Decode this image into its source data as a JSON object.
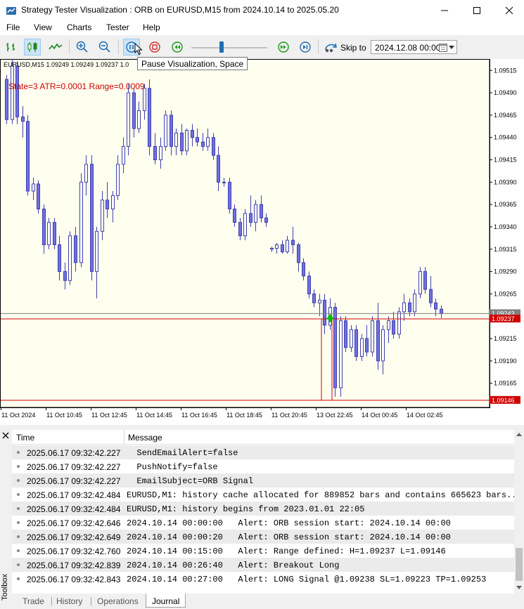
{
  "window": {
    "title": "Strategy Tester Visualization : ORB on EURUSD,M15 from 2024.10.14 to 2025.05.20"
  },
  "menu": [
    "File",
    "View",
    "Charts",
    "Tester",
    "Help"
  ],
  "toolbar": {
    "skip_label": "Skip to",
    "skip_date": "2024.12.08 00:00",
    "tooltip": "Pause Visualization, Space",
    "speed_fraction": 0.4
  },
  "chart": {
    "symbol_info": "EURUSD,M15  1.09249 1.09249 1.09237 1.0",
    "state_text": "State=3 ATR=0.0001 Range=0.0009",
    "ylim": [
      1.09138,
      1.09527
    ],
    "y_ticks": [
      "1.09515",
      "1.09490",
      "1.09465",
      "1.09440",
      "1.09415",
      "1.09390",
      "1.09365",
      "1.09340",
      "1.09315",
      "1.09290",
      "1.09265",
      "1.09215",
      "1.09190",
      "1.09165"
    ],
    "price_tags": [
      {
        "label": "1.09243",
        "value": 1.09243,
        "color": "#808080"
      },
      {
        "label": "1.09237",
        "value": 1.09237,
        "color": "#d00000"
      },
      {
        "label": "1.09146",
        "value": 1.09146,
        "color": "#d00000"
      }
    ],
    "x_ticks": [
      "11 Oct 2024",
      "11 Oct 10:45",
      "11 Oct 12:45",
      "11 Oct 14:45",
      "11 Oct 16:45",
      "11 Oct 18:45",
      "11 Oct 20:45",
      "13 Oct 22:45",
      "14 Oct 00:45",
      "14 Oct 02:45"
    ],
    "colors": {
      "bg": "#fffff0",
      "bull": "#ffffff",
      "bear": "#7070e0",
      "outline": "#4040b0",
      "range": "#cc0000",
      "arrow": "#00c000"
    }
  },
  "chart_data": {
    "type": "candlestick",
    "ohlc": [
      [
        1.09505,
        1.0951,
        1.09455,
        1.0946
      ],
      [
        1.0946,
        1.0953,
        1.09455,
        1.0952
      ],
      [
        1.0952,
        1.09525,
        1.09455,
        1.09463
      ],
      [
        1.09463,
        1.09475,
        1.0944,
        1.09458
      ],
      [
        1.09458,
        1.09465,
        1.09375,
        1.0938
      ],
      [
        1.0938,
        1.09395,
        1.0937,
        1.09388
      ],
      [
        1.09388,
        1.09392,
        1.09355,
        1.0936
      ],
      [
        1.0936,
        1.09365,
        1.0931,
        1.0932
      ],
      [
        1.0932,
        1.0935,
        1.09315,
        1.09345
      ],
      [
        1.09345,
        1.0935,
        1.09315,
        1.0932
      ],
      [
        1.0932,
        1.0933,
        1.0928,
        1.0929
      ],
      [
        1.0929,
        1.093,
        1.0927,
        1.0928
      ],
      [
        1.0928,
        1.09335,
        1.09275,
        1.0933
      ],
      [
        1.0933,
        1.0934,
        1.0929,
        1.093
      ],
      [
        1.093,
        1.094,
        1.09295,
        1.0939
      ],
      [
        1.0939,
        1.0942,
        1.09375,
        1.0941
      ],
      [
        1.0941,
        1.0942,
        1.0928,
        1.0929
      ],
      [
        1.0929,
        1.0934,
        1.0926,
        1.09335
      ],
      [
        1.09335,
        1.0938,
        1.09325,
        1.0937
      ],
      [
        1.0937,
        1.0939,
        1.0935,
        1.0936
      ],
      [
        1.0936,
        1.0938,
        1.09345,
        1.09375
      ],
      [
        1.09375,
        1.0942,
        1.0937,
        1.0941
      ],
      [
        1.0941,
        1.0944,
        1.094,
        1.0943
      ],
      [
        1.0943,
        1.095,
        1.0942,
        1.0949
      ],
      [
        1.0949,
        1.09495,
        1.0944,
        1.0945
      ],
      [
        1.0945,
        1.0948,
        1.09445,
        1.0947
      ],
      [
        1.0947,
        1.095,
        1.0946,
        1.09495
      ],
      [
        1.09495,
        1.09505,
        1.0942,
        1.0943
      ],
      [
        1.0943,
        1.09445,
        1.0941,
        1.09415
      ],
      [
        1.09415,
        1.0944,
        1.09405,
        1.0943
      ],
      [
        1.0943,
        1.0947,
        1.09425,
        1.09465
      ],
      [
        1.09465,
        1.0947,
        1.0942,
        1.0943
      ],
      [
        1.0943,
        1.0945,
        1.0942,
        1.09445
      ],
      [
        1.09445,
        1.09455,
        1.0942,
        1.09425
      ],
      [
        1.09425,
        1.0945,
        1.0942,
        1.09448
      ],
      [
        1.09448,
        1.09455,
        1.0943,
        1.0944
      ],
      [
        1.0944,
        1.0945,
        1.0943,
        1.09435
      ],
      [
        1.09435,
        1.09445,
        1.09425,
        1.0943
      ],
      [
        1.0943,
        1.0945,
        1.09425,
        1.0944
      ],
      [
        1.0944,
        1.09445,
        1.09415,
        1.0942
      ],
      [
        1.0942,
        1.0943,
        1.0938,
        1.0939
      ],
      [
        1.0939,
        1.09395,
        1.09385,
        1.0939
      ],
      [
        1.0939,
        1.09395,
        1.09355,
        1.0936
      ],
      [
        1.0936,
        1.09365,
        1.0934,
        1.09345
      ],
      [
        1.09345,
        1.0935,
        1.09325,
        1.0933
      ],
      [
        1.0933,
        1.0936,
        1.09325,
        1.09355
      ],
      [
        1.09355,
        1.09375,
        1.0934,
        1.09345
      ],
      [
        1.09345,
        1.0937,
        1.09335,
        1.09365
      ],
      [
        1.09365,
        1.09375,
        1.09345,
        1.0935
      ],
      [
        1.0935,
        1.09355,
        1.0934,
        1.09345
      ],
      [
        1.09315,
        1.09318,
        1.09312,
        1.09316
      ],
      [
        1.09316,
        1.09322,
        1.0931,
        1.0932
      ],
      [
        1.0932,
        1.09325,
        1.0931,
        1.09312
      ],
      [
        1.09312,
        1.0933,
        1.0931,
        1.09325
      ],
      [
        1.09325,
        1.0934,
        1.0931,
        1.0932
      ],
      [
        1.0932,
        1.09322,
        1.0929,
        1.093
      ],
      [
        1.093,
        1.09305,
        1.0928,
        1.09285
      ],
      [
        1.09285,
        1.0929,
        1.0926,
        1.09265
      ],
      [
        1.09265,
        1.0927,
        1.0925,
        1.09255
      ],
      [
        1.09255,
        1.09265,
        1.0924,
        1.09258
      ],
      [
        1.09258,
        1.09265,
        1.0922,
        1.0923
      ],
      [
        1.0923,
        1.0926,
        1.09225,
        1.0925
      ],
      [
        1.0925,
        1.09255,
        1.0915,
        1.0916
      ],
      [
        1.0916,
        1.0924,
        1.0915,
        1.09235
      ],
      [
        1.09235,
        1.0924,
        1.092,
        1.09205
      ],
      [
        1.09205,
        1.0923,
        1.092,
        1.09225
      ],
      [
        1.09225,
        1.0923,
        1.0919,
        1.09195
      ],
      [
        1.09195,
        1.0922,
        1.0919,
        1.09215
      ],
      [
        1.09215,
        1.0923,
        1.09195,
        1.092
      ],
      [
        1.092,
        1.0924,
        1.09195,
        1.09235
      ],
      [
        1.09235,
        1.09255,
        1.0918,
        1.0919
      ],
      [
        1.0919,
        1.0923,
        1.09175,
        1.09225
      ],
      [
        1.09225,
        1.0924,
        1.0921,
        1.09235
      ],
      [
        1.09235,
        1.09245,
        1.09215,
        1.0922
      ],
      [
        1.0922,
        1.0925,
        1.09215,
        1.09245
      ],
      [
        1.09245,
        1.09265,
        1.09235,
        1.09255
      ],
      [
        1.09255,
        1.0926,
        1.0924,
        1.09245
      ],
      [
        1.09245,
        1.0927,
        1.0924,
        1.09265
      ],
      [
        1.09265,
        1.09295,
        1.0926,
        1.0929
      ],
      [
        1.0929,
        1.09295,
        1.09265,
        1.0927
      ],
      [
        1.0927,
        1.09285,
        1.0925,
        1.09255
      ],
      [
        1.09255,
        1.0926,
        1.0924,
        1.09248
      ],
      [
        1.09248,
        1.09252,
        1.09238,
        1.09243
      ]
    ],
    "range_levels": [
      1.09237,
      1.09146
    ],
    "signal": {
      "type": "arrow-up",
      "price": 1.09238,
      "index": 61
    }
  },
  "journal": {
    "columns": [
      "Time",
      "Message"
    ],
    "rows": [
      {
        "time": "2025.06.17 09:32:42.227",
        "msg": "  SendEmailAlert=false"
      },
      {
        "time": "2025.06.17 09:32:42.227",
        "msg": "  PushNotify=false"
      },
      {
        "time": "2025.06.17 09:32:42.227",
        "msg": "  EmailSubject=ORB Signal"
      },
      {
        "time": "2025.06.17 09:32:42.484",
        "msg": "EURUSD,M1: history cache allocated for 889852 bars and contains 665623 bars..."
      },
      {
        "time": "2025.06.17 09:32:42.484",
        "msg": "EURUSD,M1: history begins from 2023.01.01 22:05"
      },
      {
        "time": "2025.06.17 09:32:42.646",
        "msg": "2024.10.14 00:00:00   Alert: ORB session start: 2024.10.14 00:00"
      },
      {
        "time": "2025.06.17 09:32:42.649",
        "msg": "2024.10.14 00:00:20   Alert: ORB session start: 2024.10.14 00:00"
      },
      {
        "time": "2025.06.17 09:32:42.760",
        "msg": "2024.10.14 00:15:00   Alert: Range defined: H=1.09237 L=1.09146"
      },
      {
        "time": "2025.06.17 09:32:42.839",
        "msg": "2024.10.14 00:26:40   Alert: Breakout Long"
      },
      {
        "time": "2025.06.17 09:32:42.843",
        "msg": "2024.10.14 00:27:00   Alert: LONG Signal @1.09238 SL=1.09223 TP=1.09253"
      }
    ]
  },
  "toolbox": {
    "label": "Toolbox",
    "tabs": [
      "Trade",
      "History",
      "Operations",
      "Journal"
    ],
    "active_tab": "Journal"
  }
}
